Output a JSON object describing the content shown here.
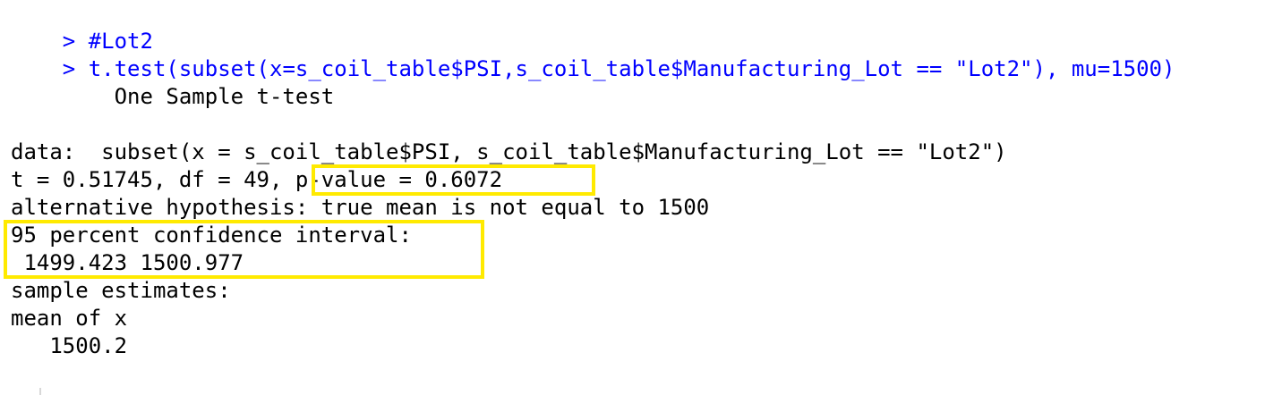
{
  "console": {
    "prompt_symbol": ">",
    "input_lines": [
      "#Lot2",
      "t.test(subset(x=s_coil_table$PSI,s_coil_table$Manufacturing_Lot == \"Lot2\"), mu=1500)"
    ],
    "output": {
      "title": "        One Sample t-test",
      "data_line": "data:  subset(x = s_coil_table$PSI, s_coil_table$Manufacturing_Lot == \"Lot2\")",
      "stats_prefix": "t = 0.51745, df = 49, ",
      "p_value": "p-value = 0.6072",
      "alternative": "alternative hypothesis: true mean is not equal to 1500",
      "ci_label": "95 percent confidence interval:",
      "ci_values": " 1499.423 1500.977",
      "estimates_label": "sample estimates:",
      "mean_label": "mean of x",
      "mean_value": "   1500.2"
    }
  },
  "highlight_color": "#ffea00",
  "input_color": "#0000ff"
}
